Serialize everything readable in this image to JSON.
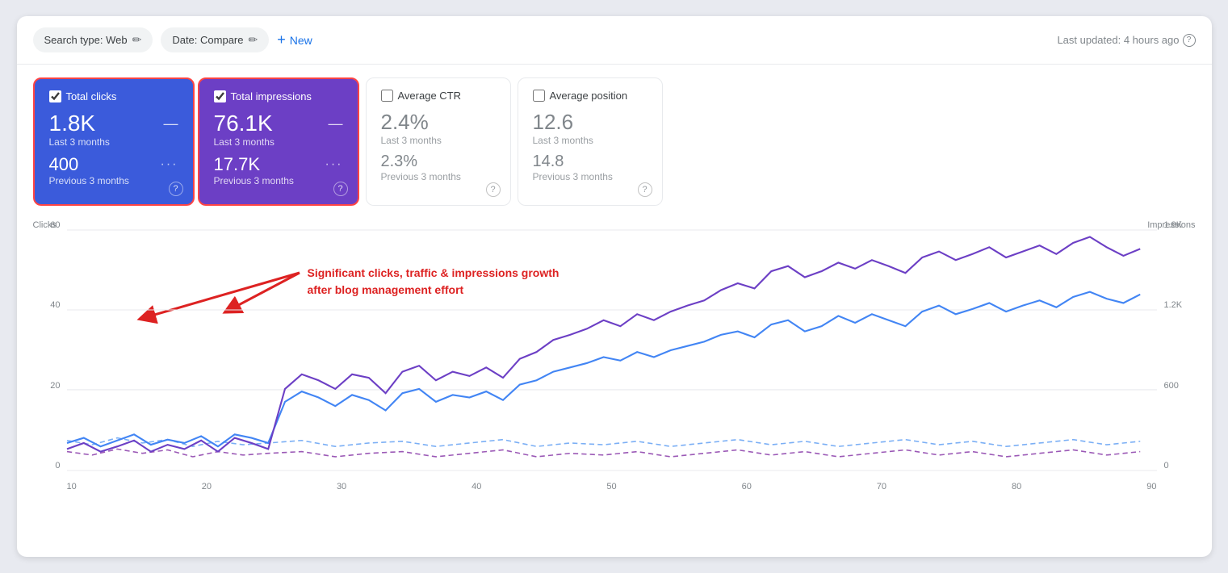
{
  "toolbar": {
    "search_type_label": "Search type: Web",
    "date_label": "Date: Compare",
    "new_label": "New",
    "last_updated": "Last updated: 4 hours ago"
  },
  "metrics": [
    {
      "id": "total-clicks",
      "label": "Total clicks",
      "checked": true,
      "style": "active-blue",
      "current_value": "1.8K",
      "current_period": "Last 3 months",
      "prev_value": "400",
      "prev_period": "Previous 3 months"
    },
    {
      "id": "total-impressions",
      "label": "Total impressions",
      "checked": true,
      "style": "active-purple",
      "current_value": "76.1K",
      "current_period": "Last 3 months",
      "prev_value": "17.7K",
      "prev_period": "Previous 3 months"
    },
    {
      "id": "average-ctr",
      "label": "Average CTR",
      "checked": false,
      "style": "inactive",
      "current_value": "2.4%",
      "current_period": "Last 3 months",
      "prev_value": "2.3%",
      "prev_period": "Previous 3 months"
    },
    {
      "id": "average-position",
      "label": "Average position",
      "checked": false,
      "style": "inactive",
      "current_value": "12.6",
      "current_period": "Last 3 months",
      "prev_value": "14.8",
      "prev_period": "Previous 3 months"
    }
  ],
  "chart": {
    "y_axis_left_label": "Clicks",
    "y_axis_right_label": "Impressions",
    "y_left_ticks": [
      "60",
      "40",
      "20",
      "0"
    ],
    "y_right_ticks": [
      "1.8K",
      "1.2K",
      "600",
      "0"
    ],
    "x_ticks": [
      "10",
      "20",
      "30",
      "40",
      "50",
      "60",
      "70",
      "80",
      "90"
    ]
  },
  "annotation": {
    "line1": "Significant clicks, traffic & impressions growth",
    "line2": "after blog management effort"
  }
}
